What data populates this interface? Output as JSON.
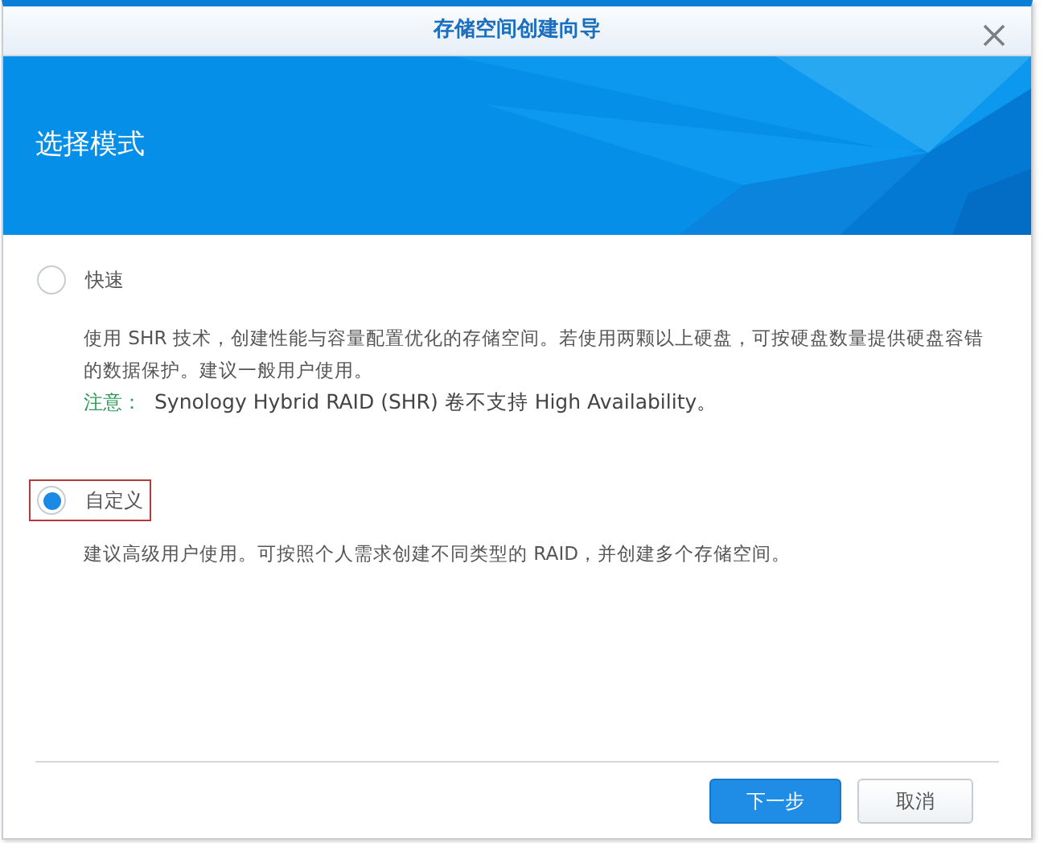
{
  "window": {
    "title": "存储空间创建向导"
  },
  "banner": {
    "title": "选择模式"
  },
  "options": [
    {
      "label": "快速",
      "selected": false,
      "highlighted": false,
      "description": "使用 SHR 技术，创建性能与容量配置优化的存储空间。若使用两颗以上硬盘，可按硬盘数量提供硬盘容错的数据保护。建议一般用户使用。",
      "note": {
        "label": "注意：",
        "text": "Synology Hybrid RAID (SHR) 卷不支持 High Availability。"
      }
    },
    {
      "label": "自定义",
      "selected": true,
      "highlighted": true,
      "description": "建议高级用户使用。可按照个人需求创建不同类型的 RAID，并创建多个存储空间。"
    }
  ],
  "buttons": [
    {
      "label": "下一步",
      "kind": "primary"
    },
    {
      "label": "取消",
      "kind": "secondary"
    }
  ]
}
